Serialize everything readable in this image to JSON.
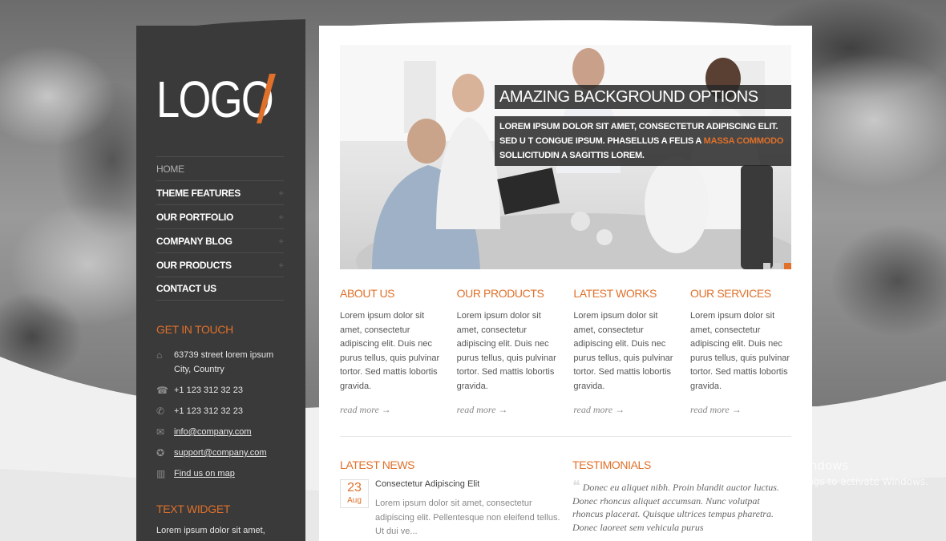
{
  "brand": {
    "logo_text": "LOGO",
    "accent": "#e0702a"
  },
  "nav": [
    {
      "label": "HOME",
      "active": true,
      "plus": ""
    },
    {
      "label": "THEME FEATURES",
      "plus": "+"
    },
    {
      "label": "OUR PORTFOLIO",
      "plus": "+"
    },
    {
      "label": "COMPANY BLOG",
      "plus": "+"
    },
    {
      "label": "OUR PRODUCTS",
      "plus": "+"
    },
    {
      "label": "CONTACT US",
      "plus": ""
    }
  ],
  "contact": {
    "heading": "GET IN TOUCH",
    "address_line1": "63739 street lorem ipsum",
    "address_line2": "City, Country",
    "phone": "+1 123 312 32 23",
    "fax": "+1 123 312 32 23",
    "email": "info@company.com",
    "support": "support@company.com",
    "map": "Find us on map"
  },
  "text_widget": {
    "heading": "TEXT WIDGET",
    "text": "Lorem ipsum dolor sit amet,"
  },
  "slider": {
    "title": "AMAZING BACKGROUND OPTIONS",
    "text_before": "LOREM IPSUM DOLOR SIT AMET, CONSECTETUR ADIPISCING ELIT. SED U T CONGUE IPSUM. PHASELLUS A FELIS A ",
    "text_highlight": "MASSA COMMODO",
    "text_after": " SOLLICITUDIN A SAGITTIS LOREM.",
    "slides": 3,
    "active_slide": 3
  },
  "columns": [
    {
      "title": "ABOUT US",
      "text": "Lorem ipsum dolor sit amet, consectetur adipiscing elit. Duis nec purus tellus, quis pulvinar tortor. Sed mattis lobortis gravida.",
      "more": "read more →"
    },
    {
      "title": "OUR PRODUCTS",
      "text": "Lorem ipsum dolor sit amet, consectetur adipiscing elit. Duis nec purus tellus, quis pulvinar tortor. Sed mattis lobortis gravida.",
      "more": "read more →"
    },
    {
      "title": "LATEST WORKS",
      "text": "Lorem ipsum dolor sit amet, consectetur adipiscing elit. Duis nec purus tellus, quis pulvinar tortor. Sed mattis lobortis gravida.",
      "more": "read more →"
    },
    {
      "title": "OUR SERVICES",
      "text": "Lorem ipsum dolor sit amet, consectetur adipiscing elit. Duis nec purus tellus, quis pulvinar tortor. Sed mattis lobortis gravida.",
      "more": "read more →"
    }
  ],
  "news": {
    "heading": "LATEST NEWS",
    "day": "23",
    "month": "Aug",
    "title": "Consectetur Adipiscing Elit",
    "text": "Lorem ipsum dolor sit amet, consectetur adipiscing elit. Pellentesque non eleifend tellus. Ut dui ve..."
  },
  "testimonials": {
    "heading": "TESTIMONIALS",
    "text": "Donec eu aliquet nibh. Proin blandit auctor luctus. Donec rhoncus aliquet accumsan. Nunc volutpat rhoncus placerat. Quisque ultrices tempus pharetra. Donec laoreet sem vehicula purus"
  },
  "watermark": {
    "line1": "Activate Windows",
    "line2": "Go to PC settings to activate Windows."
  }
}
